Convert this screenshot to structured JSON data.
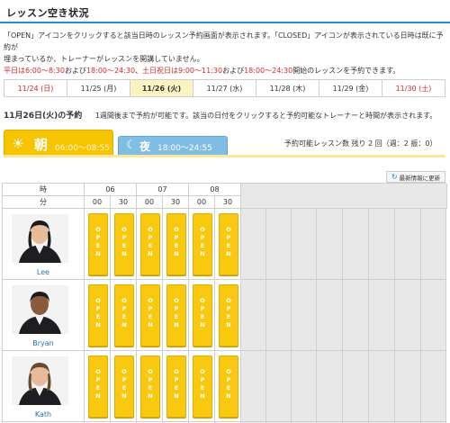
{
  "page": {
    "title": "レッスン空き状況"
  },
  "description": {
    "line1": "「OPEN」アイコンをクリックすると該当日時のレッスン予約画面が表示されます。「CLOSED」アイコンが表示されている日時は既に予約が",
    "line2": "埋まっているか、トレーナーがレッスンを開講していません。",
    "line3_parts": [
      {
        "text": "平日は6:00～8:30",
        "red": true
      },
      {
        "text": "および",
        "red": false
      },
      {
        "text": "18:00～24:30",
        "red": true
      },
      {
        "text": "、",
        "red": false
      },
      {
        "text": "土日祝日は9:00～11:30",
        "red": true
      },
      {
        "text": "および",
        "red": false
      },
      {
        "text": "18:00～24:30",
        "red": true
      },
      {
        "text": "開始のレッスンを予約できます。",
        "red": false
      }
    ]
  },
  "dates": [
    {
      "label": "11/24 (日)",
      "kind": "sun"
    },
    {
      "label": "11/25 (月)",
      "kind": ""
    },
    {
      "label": "11/26 (火)",
      "kind": "sel"
    },
    {
      "label": "11/27 (水)",
      "kind": ""
    },
    {
      "label": "11/28 (木)",
      "kind": ""
    },
    {
      "label": "11/29 (金)",
      "kind": ""
    },
    {
      "label": "11/30 (土)",
      "kind": "sat"
    }
  ],
  "day_header": {
    "date": "11月26日(火)の予約",
    "note": "1週間後まで予約が可能です。該当の日付をクリックすると予約可能なトレーナーと時間が表示されます。"
  },
  "tabs": {
    "morning": {
      "label": "朝",
      "time": "06:00～08:55"
    },
    "night": {
      "label": "夜",
      "time": "18:00～24:55"
    },
    "remaining": "予約可能レッスン数 残り 2 回（週：2 振：0）"
  },
  "refresh_label": "最新情報に更新",
  "grid": {
    "hour_label": "時",
    "minute_label": "分",
    "hours": [
      "06",
      "07",
      "08"
    ],
    "minutes": [
      "00",
      "30",
      "00",
      "30",
      "00",
      "30"
    ],
    "open_label": "OPEN",
    "trainers": [
      {
        "name": "Lee"
      },
      {
        "name": "Bryan"
      },
      {
        "name": "Kath"
      }
    ]
  },
  "colors": {
    "accent_blue": "#2a8fd0",
    "open_yellow": "#f9c910",
    "weekend_red": "#d42a2a",
    "selected_bg": "#fdf3c2"
  }
}
